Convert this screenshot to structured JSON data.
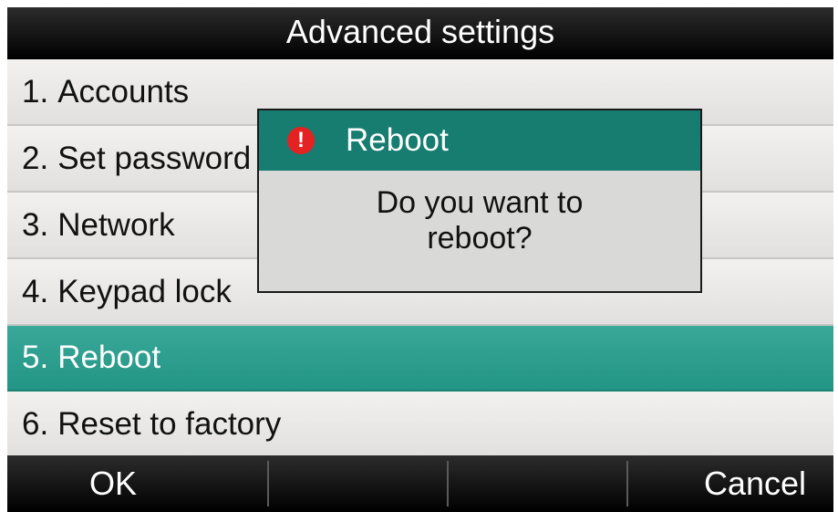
{
  "header": {
    "title": "Advanced settings"
  },
  "menu": {
    "items": [
      {
        "number": "1.",
        "label": "Accounts"
      },
      {
        "number": "2.",
        "label": "Set password"
      },
      {
        "number": "3.",
        "label": "Network"
      },
      {
        "number": "4.",
        "label": "Keypad lock"
      },
      {
        "number": "5.",
        "label": "Reboot",
        "selected": true
      },
      {
        "number": "6.",
        "label": "Reset to factory"
      }
    ]
  },
  "dialog": {
    "title": "Reboot",
    "icon": "alert-icon",
    "icon_glyph": "!",
    "message_line1": "Do you want to",
    "message_line2": "reboot?"
  },
  "softkeys": {
    "key1": "OK",
    "key2": "",
    "key3": "",
    "key4": "Cancel"
  },
  "colors": {
    "accent_selected": "#239585",
    "dialog_header": "#167d70",
    "alert": "#e52222"
  }
}
